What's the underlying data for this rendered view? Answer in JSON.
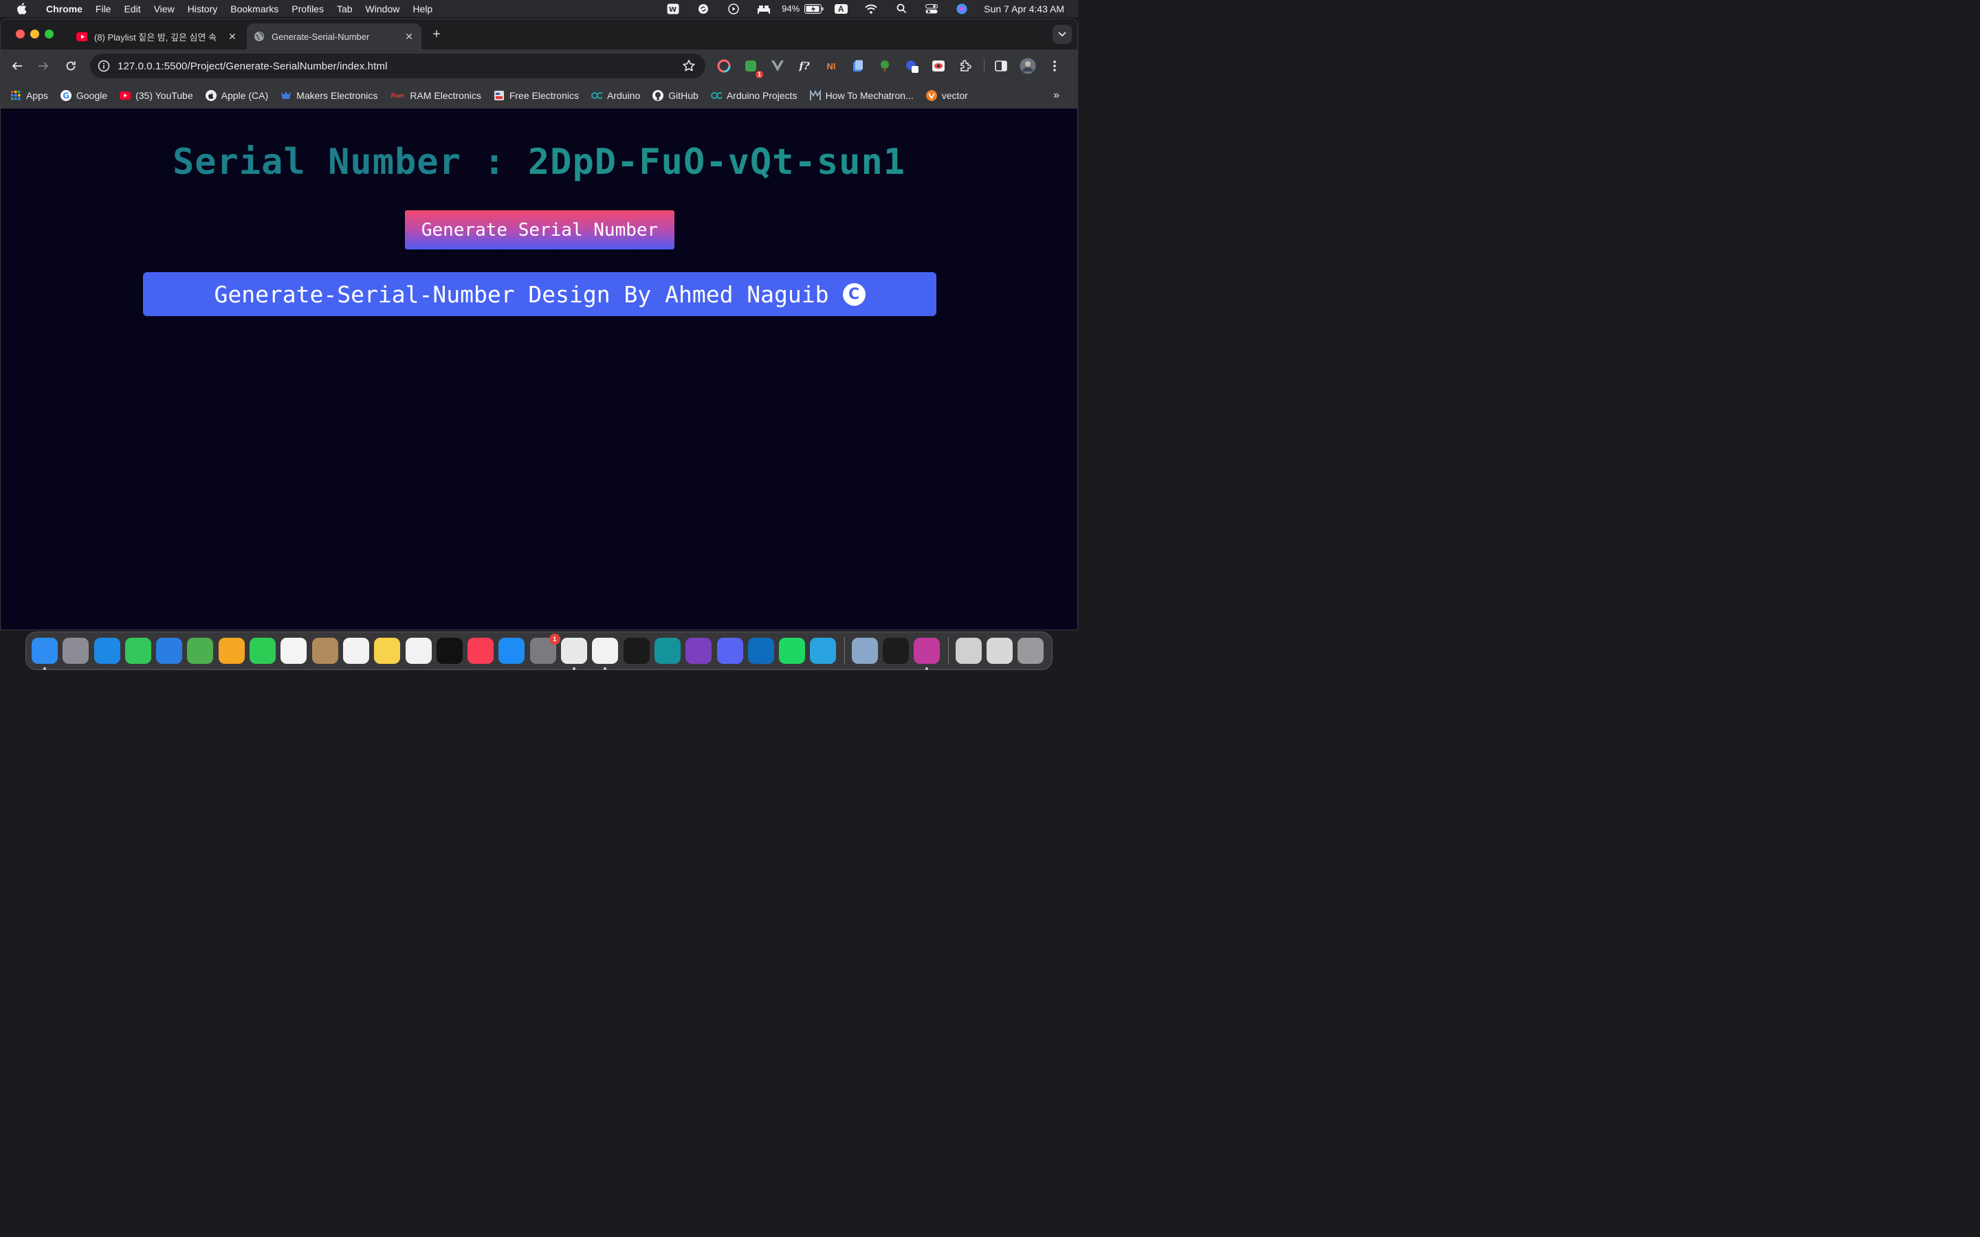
{
  "menubar": {
    "app_name": "Chrome",
    "items": [
      "File",
      "Edit",
      "View",
      "History",
      "Bookmarks",
      "Profiles",
      "Tab",
      "Window",
      "Help"
    ],
    "battery": "94%",
    "input_source": "A",
    "clock": "Sun 7 Apr  4:43 AM"
  },
  "tabs": [
    {
      "title": "(8) Playlist 짙은 밤, 깊은 심연 속",
      "favicon": "youtube-icon",
      "active": false
    },
    {
      "title": "Generate-Serial-Number",
      "favicon": "globe-icon",
      "active": true
    }
  ],
  "omnibox": {
    "url": "127.0.0.1:5500/Project/Generate-SerialNumber/index.html"
  },
  "extensions": {
    "badge_count": "1"
  },
  "bookmarks": [
    {
      "label": "Apps",
      "icon": "apps-grid-icon"
    },
    {
      "label": "Google",
      "icon": "google-icon"
    },
    {
      "label": "(35) YouTube",
      "icon": "youtube-icon"
    },
    {
      "label": "Apple (CA)",
      "icon": "apple-icon"
    },
    {
      "label": "Makers Electronics",
      "icon": "makers-icon"
    },
    {
      "label": "RAM Electronics",
      "icon": "ram-icon"
    },
    {
      "label": "Free Electronics",
      "icon": "free-electronics-icon"
    },
    {
      "label": "Arduino",
      "icon": "arduino-icon"
    },
    {
      "label": "GitHub",
      "icon": "github-icon"
    },
    {
      "label": "Arduino Projects",
      "icon": "arduino-icon"
    },
    {
      "label": "How To Mechatron...",
      "icon": "mechatronics-icon"
    },
    {
      "label": "vector",
      "icon": "vector-icon"
    }
  ],
  "page": {
    "serial_label": "Serial Number : ",
    "serial_value": "2DpD-FuO-vQt-sun1",
    "generate_button": "Generate Serial Number",
    "footer_text": "Generate-Serial-Number Design By Ahmed Naguib",
    "copyright_symbol": "C"
  },
  "dock": {
    "apps": [
      {
        "name": "Finder",
        "icon": "finder-icon",
        "color": "#2f8cf0",
        "running": true
      },
      {
        "name": "Launchpad",
        "icon": "launchpad-icon",
        "color": "#8c8c94"
      },
      {
        "name": "Safari",
        "icon": "safari-icon",
        "color": "#1e88e5"
      },
      {
        "name": "Messages",
        "icon": "messages-icon",
        "color": "#34c759"
      },
      {
        "name": "Mail",
        "icon": "mail-icon",
        "color": "#2a7de1"
      },
      {
        "name": "Maps",
        "icon": "maps-icon",
        "color": "#4caf50"
      },
      {
        "name": "Photos",
        "icon": "photos-icon",
        "color": "#f5a623"
      },
      {
        "name": "FaceTime",
        "icon": "facetime-icon",
        "color": "#2ecc55"
      },
      {
        "name": "Calendar",
        "icon": "calendar-icon",
        "color": "#f4f4f4"
      },
      {
        "name": "Contacts",
        "icon": "contacts-icon",
        "color": "#b08a5a"
      },
      {
        "name": "Reminders",
        "icon": "reminders-icon",
        "color": "#f2f2f2"
      },
      {
        "name": "Notes",
        "icon": "notes-icon",
        "color": "#f7d24a"
      },
      {
        "name": "Freeform",
        "icon": "freeform-icon",
        "color": "#f2f2f2"
      },
      {
        "name": "TV",
        "icon": "tv-icon",
        "color": "#111111"
      },
      {
        "name": "Music",
        "icon": "music-icon",
        "color": "#fa3d55"
      },
      {
        "name": "App Store",
        "icon": "app-store-icon",
        "color": "#1e8cf5"
      },
      {
        "name": "System Settings",
        "icon": "settings-icon",
        "color": "#7a7a80",
        "badge": "1"
      },
      {
        "name": "Chrome",
        "icon": "chrome-icon",
        "color": "#e8e8e8",
        "running": true
      },
      {
        "name": "VS Code",
        "icon": "vscode-icon",
        "color": "#f2f2f2",
        "running": true
      },
      {
        "name": "CLion",
        "icon": "clion-icon",
        "color": "#1a1a1a"
      },
      {
        "name": "Arduino IDE",
        "icon": "arduino-icon",
        "color": "#15939a"
      },
      {
        "name": "GitHub Desktop",
        "icon": "github-desktop-icon",
        "color": "#7b3fbf"
      },
      {
        "name": "Discord",
        "icon": "discord-icon",
        "color": "#5865f2"
      },
      {
        "name": "Outlook",
        "icon": "outlook-icon",
        "color": "#0f6cbd"
      },
      {
        "name": "Spotify",
        "icon": "spotify-icon",
        "color": "#1ed760"
      },
      {
        "name": "Telegram",
        "icon": "telegram-icon",
        "color": "#2aa3e0"
      }
    ],
    "apps_after_sep": [
      {
        "name": "Preview",
        "icon": "preview-icon",
        "color": "#8aa6c8"
      },
      {
        "name": "Terminal",
        "icon": "terminal-icon",
        "color": "#1c1c1c"
      },
      {
        "name": "WPS",
        "icon": "wps-icon",
        "color": "#c2399e",
        "running": true
      }
    ],
    "apps_trailing": [
      {
        "name": "Documents",
        "icon": "documents-stack-icon",
        "color": "#d0d0d0"
      },
      {
        "name": "Downloads",
        "icon": "downloads-stack-icon",
        "color": "#d8d8d8"
      },
      {
        "name": "Trash",
        "icon": "trash-icon",
        "color": "#9a9a9e"
      }
    ]
  }
}
